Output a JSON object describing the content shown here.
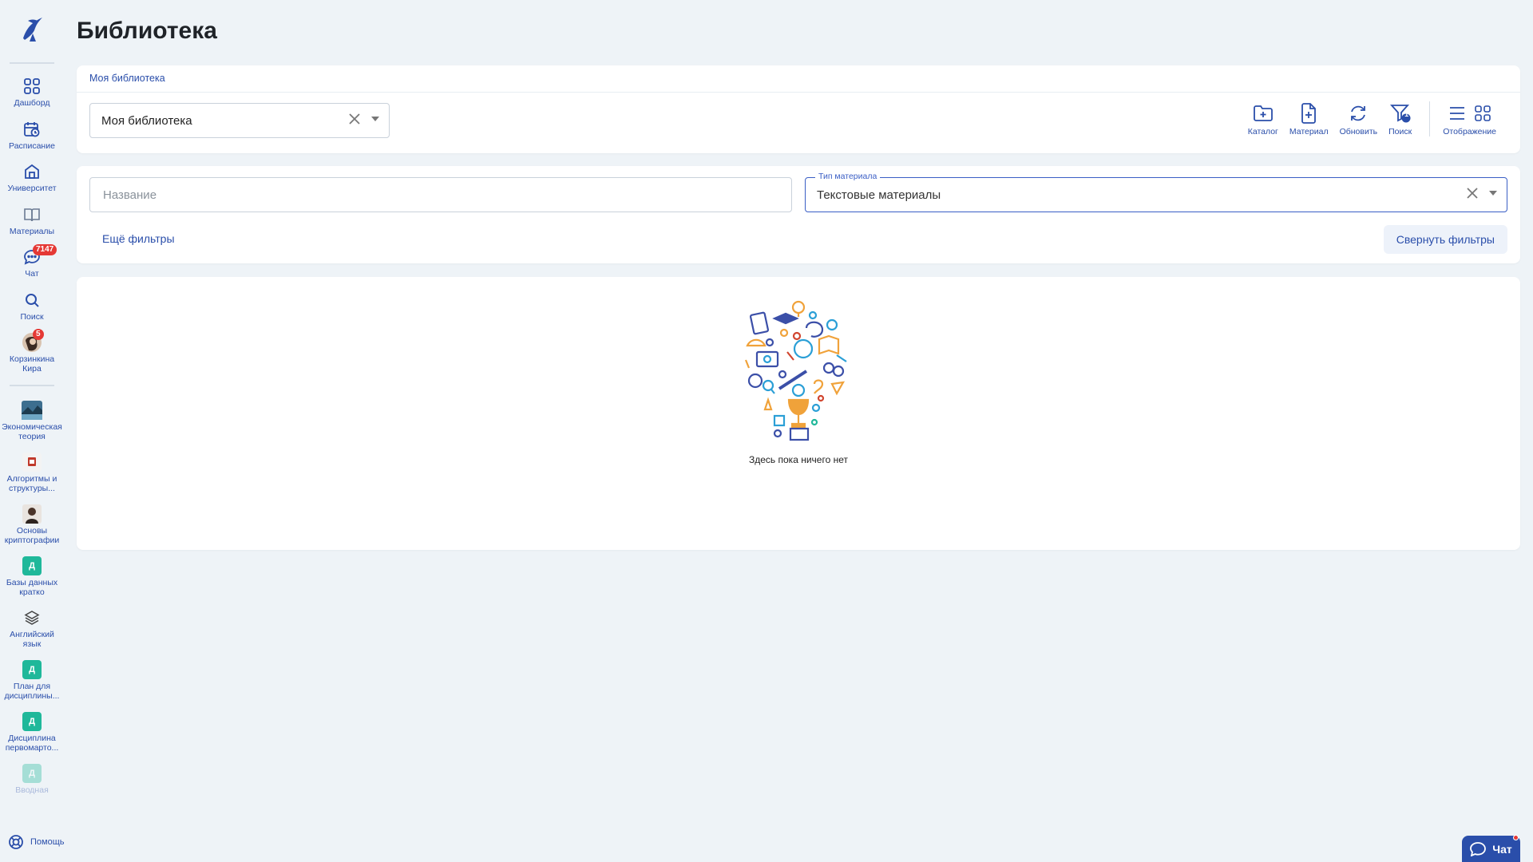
{
  "page": {
    "title": "Библиотека"
  },
  "sidebar": {
    "nav": [
      {
        "label": "Дашборд",
        "icon": "dashboard-icon"
      },
      {
        "label": "Расписание",
        "icon": "calendar-icon"
      },
      {
        "label": "Университет",
        "icon": "university-icon"
      },
      {
        "label": "Материалы",
        "icon": "book-icon"
      },
      {
        "label": "Чат",
        "icon": "chat-icon",
        "badge": "7147"
      },
      {
        "label": "Поиск",
        "icon": "search-icon"
      },
      {
        "label": "Корзинкина Кира",
        "icon": "avatar",
        "badge": "5"
      }
    ],
    "courses": [
      {
        "label": "Экономическая теория",
        "thumb": "image"
      },
      {
        "label": "Алгоритмы и структуры...",
        "thumb": "image"
      },
      {
        "label": "Основы криптографии",
        "thumb": "image"
      },
      {
        "label": "Базы данных кратко",
        "thumb": "Д"
      },
      {
        "label": "Английский язык",
        "thumb": "layers"
      },
      {
        "label": "План для дисциплины...",
        "thumb": "Д"
      },
      {
        "label": "Дисциплина первомарто...",
        "thumb": "Д"
      },
      {
        "label": "Вводная",
        "thumb": "Д"
      }
    ],
    "help_label": "Помощь"
  },
  "library": {
    "breadcrumb": "Моя библиотека",
    "selected_library": "Моя библиотека",
    "toolbar": {
      "catalog": "Каталог",
      "material": "Материал",
      "refresh": "Обновить",
      "search": "Поиск",
      "search_badge": "1",
      "display": "Отображение"
    }
  },
  "filters": {
    "name_placeholder": "Название",
    "type_label": "Тип материала",
    "type_value": "Текстовые материалы",
    "more_filters": "Ещё фильтры",
    "collapse_filters": "Свернуть фильтры"
  },
  "content": {
    "empty_text": "Здесь пока ничего нет"
  },
  "chat_widget": {
    "label": "Чат"
  },
  "colors": {
    "accent": "#2a4eaa",
    "badge": "#e53935",
    "course_green": "#1fb89a",
    "background": "#eef3f7"
  }
}
